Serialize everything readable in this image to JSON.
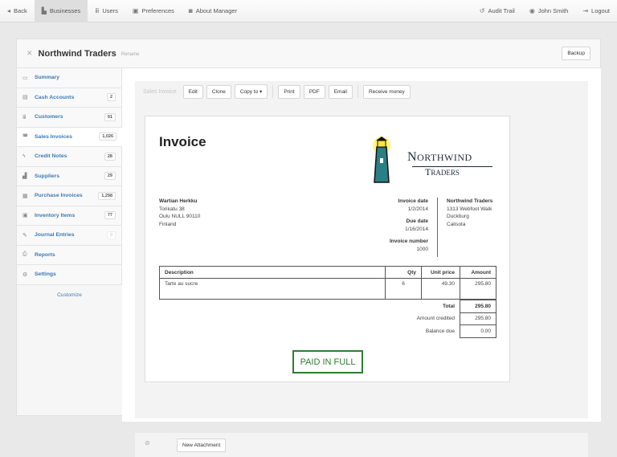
{
  "topnav": {
    "back": "Back",
    "businesses": "Businesses",
    "users": "Users",
    "preferences": "Preferences",
    "about": "About Manager",
    "audit": "Audit Trail",
    "user": "John Smith",
    "logout": "Logout"
  },
  "business": {
    "title": "Northwind Traders",
    "rename": "Rename",
    "backup": "Backup"
  },
  "sidebar": {
    "items": [
      {
        "label": "Summary",
        "count": null
      },
      {
        "label": "Cash Accounts",
        "count": "2"
      },
      {
        "label": "Customers",
        "count": "91"
      },
      {
        "label": "Sales Invoices",
        "count": "1,026"
      },
      {
        "label": "Credit Notes",
        "count": "28"
      },
      {
        "label": "Suppliers",
        "count": "29"
      },
      {
        "label": "Purchase Invoices",
        "count": "1,298"
      },
      {
        "label": "Inventory Items",
        "count": "77"
      },
      {
        "label": "Journal Entries",
        "count": "0"
      },
      {
        "label": "Reports",
        "count": null
      },
      {
        "label": "Settings",
        "count": null
      }
    ],
    "customize": "Customize"
  },
  "toolbar": {
    "label": "Sales Invoice",
    "edit": "Edit",
    "clone": "Clone",
    "copy_to": "Copy to",
    "print": "Print",
    "pdf": "PDF",
    "email": "Email",
    "receive": "Receive money"
  },
  "invoice": {
    "title": "Invoice",
    "logo_text": "NORTHWIND TRADERS",
    "customer": {
      "name": "Wartian Herkku",
      "line1": "Torikatu 38",
      "line2": "Oulu NULL 90110",
      "line3": "Finland"
    },
    "date_label": "Invoice date",
    "date": "1/2/2014",
    "due_label": "Due date",
    "due": "1/16/2014",
    "number_label": "Invoice number",
    "number": "1000",
    "company": {
      "name": "Northwind Traders",
      "line1": "1313 Webfoot Walk",
      "line2": "Duckburg",
      "line3": "Calisota"
    },
    "columns": {
      "description": "Description",
      "qty": "Qty",
      "unit_price": "Unit price",
      "amount": "Amount"
    },
    "lines": [
      {
        "description": "Tarte au sucre",
        "qty": "6",
        "unit_price": "49.30",
        "amount": "295.80"
      }
    ],
    "total_label": "Total",
    "total": "295.80",
    "credited_label": "Amount credited",
    "credited": "295.80",
    "balance_label": "Balance due",
    "balance": "0.00",
    "stamp": "PAID IN FULL"
  },
  "attachment": {
    "new": "New Attachment"
  },
  "colors": {
    "link": "#3a7ab8",
    "paid": "#2e7d32"
  }
}
